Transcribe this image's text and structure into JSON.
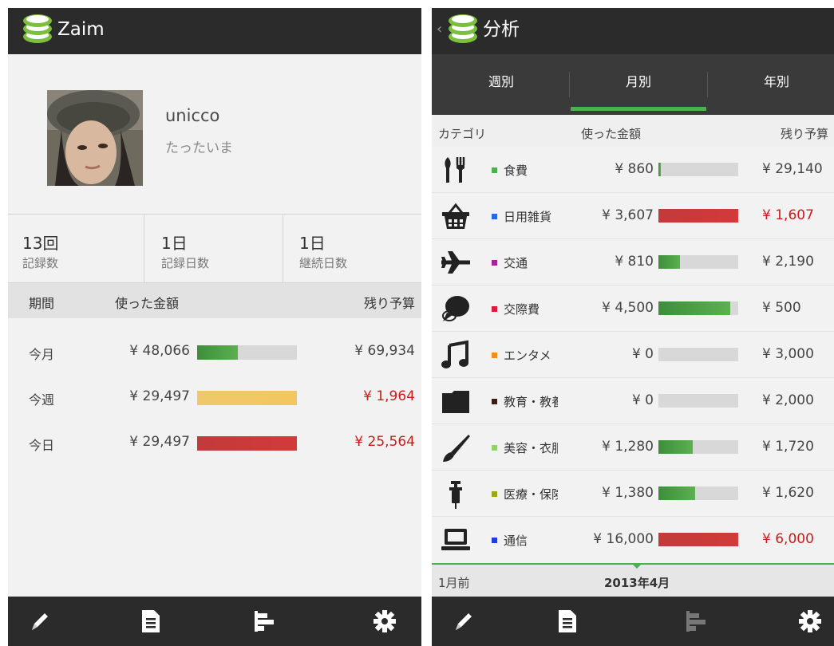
{
  "left": {
    "app_title": "Zaim",
    "profile": {
      "username": "unicco",
      "last_seen": "たったいま"
    },
    "stats": [
      {
        "value": "13回",
        "label": "記録数"
      },
      {
        "value": "1日",
        "label": "記録日数"
      },
      {
        "value": "1日",
        "label": "継続日数"
      }
    ],
    "period_header": {
      "period": "期間",
      "spent": "使った金額",
      "remaining": "残り予算"
    },
    "periods": [
      {
        "label": "今月",
        "amount": "¥ 48,066",
        "progress": 0.41,
        "color": "green",
        "remaining": "¥ 69,934",
        "negative": false
      },
      {
        "label": "今週",
        "amount": "¥ 29,497",
        "progress": 1.0,
        "color": "yellow",
        "remaining": "¥ 1,964",
        "negative": true
      },
      {
        "label": "今日",
        "amount": "¥ 29,497",
        "progress": 1.0,
        "color": "red",
        "remaining": "¥ 25,564",
        "negative": true
      }
    ]
  },
  "right": {
    "app_title": "分析",
    "tabs": [
      "週別",
      "月別",
      "年別"
    ],
    "active_tab": "月別",
    "cat_header": {
      "category": "カテゴリ",
      "spent": "使った金額",
      "remaining": "残り予算"
    },
    "categories": [
      {
        "icon": "fork-knife-icon",
        "color": "#4caf50",
        "name": "食費",
        "amount": "¥ 860",
        "progress": 0.03,
        "bar": "green",
        "remaining": "¥ 29,140",
        "negative": false
      },
      {
        "icon": "basket-icon",
        "color": "#1e6fd9",
        "name": "日用雑貨",
        "amount": "¥ 3,607",
        "progress": 1.0,
        "bar": "red",
        "remaining": "¥ 1,607",
        "negative": true
      },
      {
        "icon": "airplane-icon",
        "color": "#a3249a",
        "name": "交通",
        "amount": "¥ 810",
        "progress": 0.27,
        "bar": "green",
        "remaining": "¥ 2,190",
        "negative": false
      },
      {
        "icon": "speech-bubble-icon",
        "color": "#e0193b",
        "name": "交際費",
        "amount": "¥ 4,500",
        "progress": 0.9,
        "bar": "green",
        "remaining": "¥ 500",
        "negative": false
      },
      {
        "icon": "music-note-icon",
        "color": "#f28c1e",
        "name": "エンタメ",
        "amount": "¥ 0",
        "progress": 0.0,
        "bar": "green",
        "remaining": "¥ 3,000",
        "negative": false
      },
      {
        "icon": "folder-icon",
        "color": "#3a1e14",
        "name": "教育・教養",
        "amount": "¥ 0",
        "progress": 0.0,
        "bar": "green",
        "remaining": "¥ 2,000",
        "negative": false
      },
      {
        "icon": "brush-icon",
        "color": "#8fd46a",
        "name": "美容・衣服",
        "amount": "¥ 1,280",
        "progress": 0.43,
        "bar": "green",
        "remaining": "¥ 1,720",
        "negative": false
      },
      {
        "icon": "syringe-icon",
        "color": "#9aa814",
        "name": "医療・保険",
        "amount": "¥ 1,380",
        "progress": 0.46,
        "bar": "green",
        "remaining": "¥ 1,620",
        "negative": false
      },
      {
        "icon": "laptop-icon",
        "color": "#1e3fd0",
        "name": "通信",
        "amount": "¥ 16,000",
        "progress": 1.0,
        "bar": "red",
        "remaining": "¥ 6,000",
        "negative": true
      }
    ],
    "month_nav": {
      "prev": "1月前",
      "current": "2013年4月"
    }
  },
  "nav": [
    "pencil-icon",
    "document-icon",
    "bar-chart-icon",
    "gear-icon"
  ],
  "colors": {
    "accent": "#4caf50",
    "appbar": "#2b2b2b",
    "negative": "#cc1b1b"
  }
}
